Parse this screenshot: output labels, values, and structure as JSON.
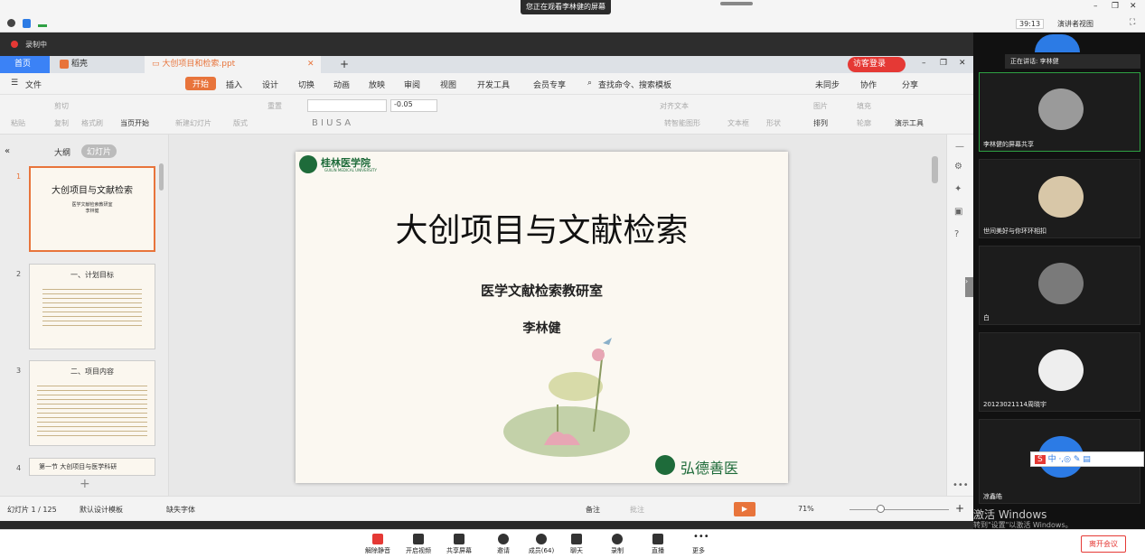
{
  "meeting": {
    "banner": "您正在观看李林健的屏幕",
    "timer": "39:13",
    "view_label": "演讲者视图",
    "recording": "录制中",
    "speaking": "正在讲话: 李林健"
  },
  "tabs": {
    "home": "首页",
    "daoke": "稻壳",
    "file": "大创项目和检索.ppt",
    "login": "访客登录"
  },
  "ribbon": {
    "file": "文件",
    "items": [
      "开始",
      "插入",
      "设计",
      "切换",
      "动画",
      "放映",
      "审阅",
      "视图",
      "开发工具",
      "会员专享"
    ],
    "search": "查找命令、搜索模板",
    "sync": "未同步",
    "collab": "协作",
    "share": "分享"
  },
  "toolbar": {
    "paste": "粘贴",
    "cut": "剪切",
    "copy": "复制",
    "format": "格式刷",
    "play": "当页开始",
    "new_slide": "新建幻灯片",
    "layout": "版式",
    "reset": "重置",
    "font_size": "-0.05",
    "align": "对齐文本",
    "smartart": "转智能图形",
    "textbox": "文本框",
    "shape": "形状",
    "arrange": "排列",
    "outline": "轮廓",
    "picture": "图片",
    "fill": "填充",
    "present": "演示工具"
  },
  "panel": {
    "outline": "大纲",
    "slides": "幻灯片",
    "thumbs": [
      {
        "num": "1",
        "title": "大创项目与文献检索",
        "sub": "医学文献检索教研室",
        "author": "李林健"
      },
      {
        "num": "2",
        "title": "一、计划目标"
      },
      {
        "num": "3",
        "title": "二、项目内容"
      },
      {
        "num": "4",
        "title": "第一节 大创项目与医学科研"
      }
    ]
  },
  "slide": {
    "logo": "桂林医学院",
    "logo_en": "GUILIN MEDICAL UNIVERSITY",
    "title": "大创项目与文献检索",
    "subtitle": "医学文献检索教研室",
    "author": "李林健",
    "motto": "弘德善医"
  },
  "status": {
    "page": "幻灯片 1 / 125",
    "template": "默认设计模板",
    "font": "缺失字体",
    "notes": "备注",
    "comment": "批注",
    "zoom": "71%"
  },
  "gallery": [
    {
      "name": "李林健的屏幕共享"
    },
    {
      "name": "世间美好与你环环相扣"
    },
    {
      "name": "白"
    },
    {
      "name": "20123021114周晓宇"
    },
    {
      "name": "凉鑫皓"
    }
  ],
  "watermark": {
    "line1": "激活 Windows",
    "line2": "转到\"设置\"以激活 Windows。"
  },
  "bottom": {
    "buttons": [
      "解除静音",
      "开启视频",
      "共享屏幕",
      "邀请",
      "成员(64)",
      "聊天",
      "录制",
      "直播",
      "更多"
    ],
    "leave": "离开会议"
  },
  "colors": {
    "accent": "#e8743b",
    "tab_active": "#3b82f6",
    "leave": "#e53935"
  }
}
